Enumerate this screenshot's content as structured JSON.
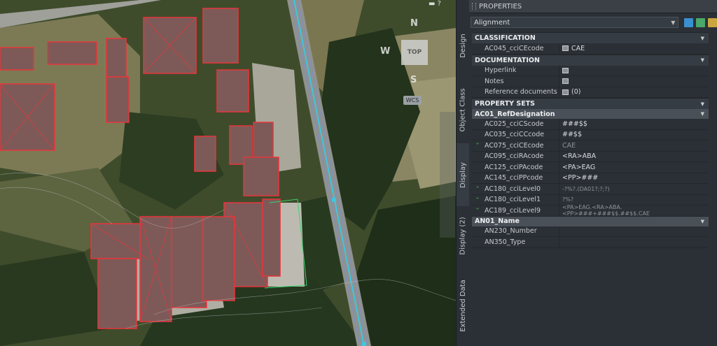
{
  "viewcube": {
    "north": "N",
    "west": "W",
    "south": "S",
    "top": "TOP",
    "wcs": "WCS"
  },
  "panel": {
    "title": "PROPERTIES",
    "object_type": "Alignment",
    "side_tabs": [
      "Design",
      "Object Class",
      "Display",
      "Display (2)",
      "Extended Data"
    ],
    "sections": {
      "classification": {
        "label": "CLASSIFICATION",
        "rows": [
          {
            "name": "AC045_cciCEcode",
            "value": "CAE"
          }
        ]
      },
      "documentation": {
        "label": "DOCUMENTATION",
        "rows": [
          {
            "name": "Hyperlink",
            "value": ""
          },
          {
            "name": "Notes",
            "value": ""
          },
          {
            "name": "Reference documents",
            "value": "(0)"
          }
        ]
      },
      "property_sets": {
        "label": "PROPERTY SETS"
      },
      "ac01": {
        "label": "AC01_RefDesignation",
        "rows": [
          {
            "name": "AC025_cciCScode",
            "value": "###$$"
          },
          {
            "name": "AC035_cciCCcode",
            "value": "##$$"
          },
          {
            "name": "AC075_cciCEcode",
            "value": "CAE"
          },
          {
            "name": "AC095_cciRAcode",
            "value": "<RA>ABA"
          },
          {
            "name": "AC125_cciPAcode",
            "value": "<PA>EAG"
          },
          {
            "name": "AC145_cciPPcode",
            "value": "<PP>###"
          },
          {
            "name": "AC180_cciLevel0",
            "value": "-?%?.(DA01?;?;?)"
          },
          {
            "name": "AC180_cciLevel1",
            "value": "?%?"
          },
          {
            "name": "AC189_cciLevel9",
            "value": "<PA>EAG.<RA>ABA.<PP>###+###$$.##$$.CAE"
          }
        ]
      },
      "an01": {
        "label": "AN01_Name",
        "rows": [
          {
            "name": "AN230_Number",
            "value": ""
          },
          {
            "name": "AN350_Type",
            "value": ""
          }
        ]
      }
    }
  },
  "colors": {
    "building_outline": "#e8343a",
    "road_line": "#3ec6e0",
    "panel_bg": "#2b3036",
    "section_bg": "#363c43"
  }
}
